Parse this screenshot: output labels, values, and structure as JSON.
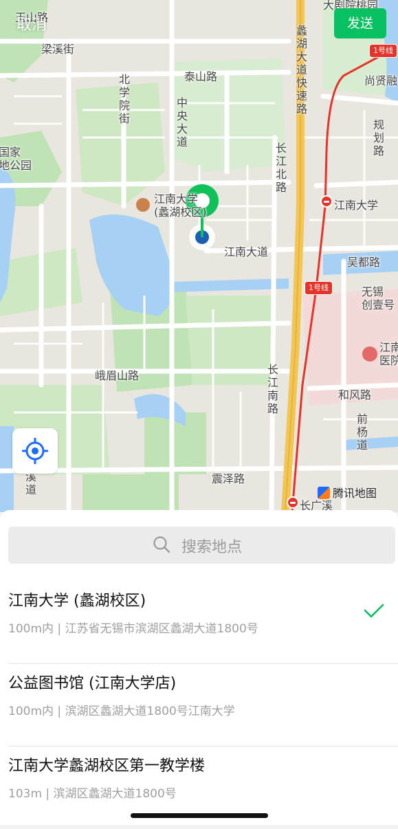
{
  "header": {
    "cancel_label": "取消",
    "send_label": "发送"
  },
  "map": {
    "labels": {
      "top_road": "玉山路",
      "liangxi": "梁溪街",
      "top_right": "大剧院桃园",
      "taishan": "泰山路",
      "north_school": "北学院街",
      "central": "中央大道",
      "expressway": "蠡湖大道快速路",
      "shangxian": "尚贤融",
      "guihua": "规划路",
      "national_park": "国家\n地公园",
      "changjiang_north": "长江北路",
      "campus_poi": "江南大学\n(蠡湖校区)",
      "station_jiangnan": "江南大学",
      "jiangnan_ave": "江南大道",
      "wudu": "吴都路",
      "wuxi_chuangyi": "无锡\n创壹号",
      "hospital": "江南\n医院",
      "emei": "峨眉山路",
      "changjiang_south": "长江南路",
      "hefeng": "和风路",
      "qianyang": "前杨道",
      "xi": "溪道",
      "zhenze": "震泽路",
      "station_bottom": "长广溪"
    },
    "metro_line": "1号线",
    "watermark": "腾讯地图",
    "colors": {
      "water": "#a7d0f5",
      "green": "#bfe3b4",
      "road": "#ffffff",
      "arterial": "#f3c553",
      "metro": "#e6332a",
      "pin": "#10c15a",
      "dot": "#1a5fb4"
    }
  },
  "search": {
    "placeholder": "搜索地点"
  },
  "places": [
    {
      "name": "江南大学 (蠡湖校区)",
      "address": "100m内 | 江苏省无锡市滨湖区蠡湖大道1800号",
      "selected": true
    },
    {
      "name": "公益图书馆 (江南大学店)",
      "address": "100m内 | 滨湖区蠡湖大道1800号江南大学",
      "selected": false
    },
    {
      "name": "江南大学蠡湖校区第一教学楼",
      "address": "103m | 滨湖区蠡湖大道1800号",
      "selected": false
    }
  ],
  "accent": "#07c160"
}
